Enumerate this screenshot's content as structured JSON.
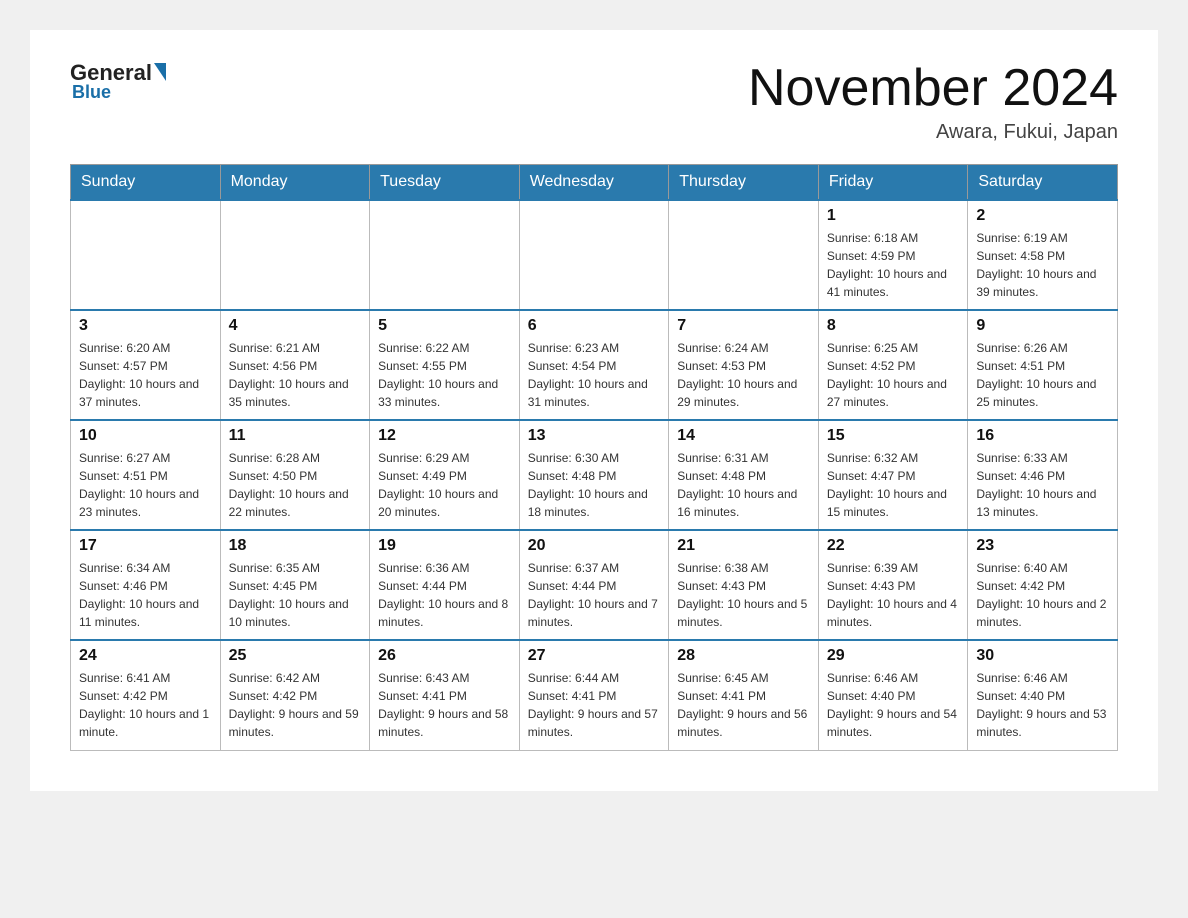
{
  "logo": {
    "general": "General",
    "blue": "Blue"
  },
  "header": {
    "month": "November 2024",
    "location": "Awara, Fukui, Japan"
  },
  "weekdays": [
    "Sunday",
    "Monday",
    "Tuesday",
    "Wednesday",
    "Thursday",
    "Friday",
    "Saturday"
  ],
  "weeks": [
    [
      {
        "day": "",
        "info": ""
      },
      {
        "day": "",
        "info": ""
      },
      {
        "day": "",
        "info": ""
      },
      {
        "day": "",
        "info": ""
      },
      {
        "day": "",
        "info": ""
      },
      {
        "day": "1",
        "info": "Sunrise: 6:18 AM\nSunset: 4:59 PM\nDaylight: 10 hours and 41 minutes."
      },
      {
        "day": "2",
        "info": "Sunrise: 6:19 AM\nSunset: 4:58 PM\nDaylight: 10 hours and 39 minutes."
      }
    ],
    [
      {
        "day": "3",
        "info": "Sunrise: 6:20 AM\nSunset: 4:57 PM\nDaylight: 10 hours and 37 minutes."
      },
      {
        "day": "4",
        "info": "Sunrise: 6:21 AM\nSunset: 4:56 PM\nDaylight: 10 hours and 35 minutes."
      },
      {
        "day": "5",
        "info": "Sunrise: 6:22 AM\nSunset: 4:55 PM\nDaylight: 10 hours and 33 minutes."
      },
      {
        "day": "6",
        "info": "Sunrise: 6:23 AM\nSunset: 4:54 PM\nDaylight: 10 hours and 31 minutes."
      },
      {
        "day": "7",
        "info": "Sunrise: 6:24 AM\nSunset: 4:53 PM\nDaylight: 10 hours and 29 minutes."
      },
      {
        "day": "8",
        "info": "Sunrise: 6:25 AM\nSunset: 4:52 PM\nDaylight: 10 hours and 27 minutes."
      },
      {
        "day": "9",
        "info": "Sunrise: 6:26 AM\nSunset: 4:51 PM\nDaylight: 10 hours and 25 minutes."
      }
    ],
    [
      {
        "day": "10",
        "info": "Sunrise: 6:27 AM\nSunset: 4:51 PM\nDaylight: 10 hours and 23 minutes."
      },
      {
        "day": "11",
        "info": "Sunrise: 6:28 AM\nSunset: 4:50 PM\nDaylight: 10 hours and 22 minutes."
      },
      {
        "day": "12",
        "info": "Sunrise: 6:29 AM\nSunset: 4:49 PM\nDaylight: 10 hours and 20 minutes."
      },
      {
        "day": "13",
        "info": "Sunrise: 6:30 AM\nSunset: 4:48 PM\nDaylight: 10 hours and 18 minutes."
      },
      {
        "day": "14",
        "info": "Sunrise: 6:31 AM\nSunset: 4:48 PM\nDaylight: 10 hours and 16 minutes."
      },
      {
        "day": "15",
        "info": "Sunrise: 6:32 AM\nSunset: 4:47 PM\nDaylight: 10 hours and 15 minutes."
      },
      {
        "day": "16",
        "info": "Sunrise: 6:33 AM\nSunset: 4:46 PM\nDaylight: 10 hours and 13 minutes."
      }
    ],
    [
      {
        "day": "17",
        "info": "Sunrise: 6:34 AM\nSunset: 4:46 PM\nDaylight: 10 hours and 11 minutes."
      },
      {
        "day": "18",
        "info": "Sunrise: 6:35 AM\nSunset: 4:45 PM\nDaylight: 10 hours and 10 minutes."
      },
      {
        "day": "19",
        "info": "Sunrise: 6:36 AM\nSunset: 4:44 PM\nDaylight: 10 hours and 8 minutes."
      },
      {
        "day": "20",
        "info": "Sunrise: 6:37 AM\nSunset: 4:44 PM\nDaylight: 10 hours and 7 minutes."
      },
      {
        "day": "21",
        "info": "Sunrise: 6:38 AM\nSunset: 4:43 PM\nDaylight: 10 hours and 5 minutes."
      },
      {
        "day": "22",
        "info": "Sunrise: 6:39 AM\nSunset: 4:43 PM\nDaylight: 10 hours and 4 minutes."
      },
      {
        "day": "23",
        "info": "Sunrise: 6:40 AM\nSunset: 4:42 PM\nDaylight: 10 hours and 2 minutes."
      }
    ],
    [
      {
        "day": "24",
        "info": "Sunrise: 6:41 AM\nSunset: 4:42 PM\nDaylight: 10 hours and 1 minute."
      },
      {
        "day": "25",
        "info": "Sunrise: 6:42 AM\nSunset: 4:42 PM\nDaylight: 9 hours and 59 minutes."
      },
      {
        "day": "26",
        "info": "Sunrise: 6:43 AM\nSunset: 4:41 PM\nDaylight: 9 hours and 58 minutes."
      },
      {
        "day": "27",
        "info": "Sunrise: 6:44 AM\nSunset: 4:41 PM\nDaylight: 9 hours and 57 minutes."
      },
      {
        "day": "28",
        "info": "Sunrise: 6:45 AM\nSunset: 4:41 PM\nDaylight: 9 hours and 56 minutes."
      },
      {
        "day": "29",
        "info": "Sunrise: 6:46 AM\nSunset: 4:40 PM\nDaylight: 9 hours and 54 minutes."
      },
      {
        "day": "30",
        "info": "Sunrise: 6:46 AM\nSunset: 4:40 PM\nDaylight: 9 hours and 53 minutes."
      }
    ]
  ]
}
